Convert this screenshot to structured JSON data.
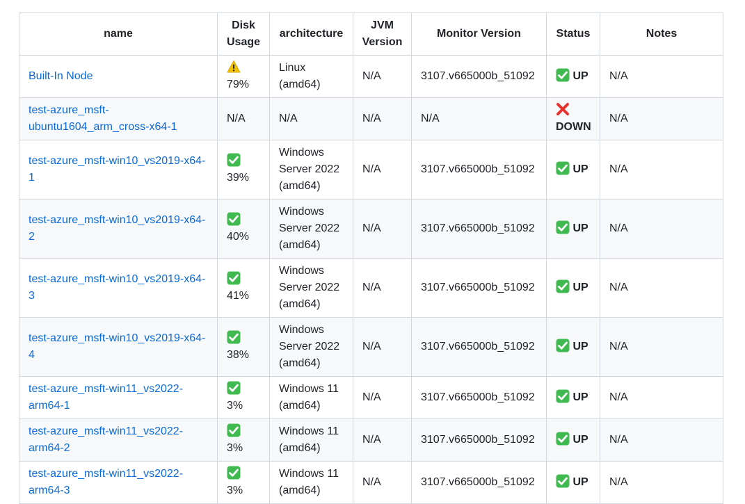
{
  "columns": {
    "name": "name",
    "disk_usage": "Disk Usage",
    "architecture": "architecture",
    "jvm_version": "JVM Version",
    "monitor_version": "Monitor Version",
    "status": "Status",
    "notes": "Notes"
  },
  "colors": {
    "link": "#0969da",
    "check_bg": "#3fb950",
    "cross": "#e5322d",
    "warning": "#f2c400",
    "border": "#d0d7de",
    "stripe": "#f6f8fa"
  },
  "rows": [
    {
      "name": "Built-In Node",
      "disk_icon": "warning-icon",
      "disk": "79%",
      "architecture": "Linux (amd64)",
      "jvm": "N/A",
      "monitor": "3107.v665000b_51092",
      "status_icon": "check-mark-icon",
      "status": "UP",
      "notes": "N/A"
    },
    {
      "name": "test-azure_msft-ubuntu1604_arm_cross-x64-1",
      "disk_icon": "",
      "disk": "N/A",
      "architecture": "N/A",
      "jvm": "N/A",
      "monitor": "N/A",
      "status_icon": "cross-mark-icon",
      "status": "DOWN",
      "notes": "N/A"
    },
    {
      "name": "test-azure_msft-win10_vs2019-x64-1",
      "disk_icon": "check-mark-icon",
      "disk": "39%",
      "architecture": "Windows Server 2022 (amd64)",
      "jvm": "N/A",
      "monitor": "3107.v665000b_51092",
      "status_icon": "check-mark-icon",
      "status": "UP",
      "notes": "N/A"
    },
    {
      "name": "test-azure_msft-win10_vs2019-x64-2",
      "disk_icon": "check-mark-icon",
      "disk": "40%",
      "architecture": "Windows Server 2022 (amd64)",
      "jvm": "N/A",
      "monitor": "3107.v665000b_51092",
      "status_icon": "check-mark-icon",
      "status": "UP",
      "notes": "N/A"
    },
    {
      "name": "test-azure_msft-win10_vs2019-x64-3",
      "disk_icon": "check-mark-icon",
      "disk": "41%",
      "architecture": "Windows Server 2022 (amd64)",
      "jvm": "N/A",
      "monitor": "3107.v665000b_51092",
      "status_icon": "check-mark-icon",
      "status": "UP",
      "notes": "N/A"
    },
    {
      "name": "test-azure_msft-win10_vs2019-x64-4",
      "disk_icon": "check-mark-icon",
      "disk": "38%",
      "architecture": "Windows Server 2022 (amd64)",
      "jvm": "N/A",
      "monitor": "3107.v665000b_51092",
      "status_icon": "check-mark-icon",
      "status": "UP",
      "notes": "N/A"
    },
    {
      "name": "test-azure_msft-win11_vs2022-arm64-1",
      "disk_icon": "check-mark-icon",
      "disk": "3%",
      "architecture": "Windows 11 (amd64)",
      "jvm": "N/A",
      "monitor": "3107.v665000b_51092",
      "status_icon": "check-mark-icon",
      "status": "UP",
      "notes": "N/A"
    },
    {
      "name": "test-azure_msft-win11_vs2022-arm64-2",
      "disk_icon": "check-mark-icon",
      "disk": "3%",
      "architecture": "Windows 11 (amd64)",
      "jvm": "N/A",
      "monitor": "3107.v665000b_51092",
      "status_icon": "check-mark-icon",
      "status": "UP",
      "notes": "N/A"
    },
    {
      "name": "test-azure_msft-win11_vs2022-arm64-3",
      "disk_icon": "check-mark-icon",
      "disk": "3%",
      "architecture": "Windows 11 (amd64)",
      "jvm": "N/A",
      "monitor": "3107.v665000b_51092",
      "status_icon": "check-mark-icon",
      "status": "UP",
      "notes": "N/A"
    }
  ]
}
